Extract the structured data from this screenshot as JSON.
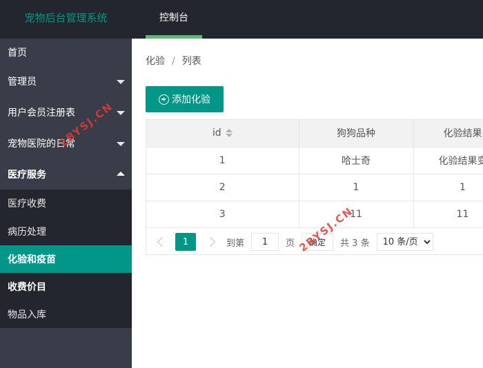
{
  "app": {
    "title": "宠物后台管理系统"
  },
  "topnav": {
    "tab_label": "控制台"
  },
  "sidebar": {
    "items": [
      {
        "label": "首页"
      },
      {
        "label": "管理员"
      },
      {
        "label": "用户会员注册表"
      },
      {
        "label": "宠物医院的日常"
      },
      {
        "label": "医疗服务"
      },
      {
        "label": "医疗收费"
      },
      {
        "label": "病历处理"
      },
      {
        "label": "化验和疫苗"
      },
      {
        "label": "收费价目"
      },
      {
        "label": "物品入库"
      }
    ]
  },
  "breadcrumb": {
    "parent": "化验",
    "separator": "/",
    "current": "列表"
  },
  "toolbar": {
    "add_label": "添加化验"
  },
  "table": {
    "columns": [
      "id",
      "狗狗品种",
      "化验结果"
    ],
    "rows": [
      [
        "1",
        "哈士奇",
        "化验结果变"
      ],
      [
        "2",
        "1",
        "1"
      ],
      [
        "3",
        "11",
        "11"
      ]
    ]
  },
  "pager": {
    "current_page": "1",
    "goto_label": "到第",
    "goto_value": "1",
    "page_suffix": "页",
    "confirm_label": "确定",
    "total_label": "共 3 条",
    "page_size": "10 条/页"
  },
  "watermark": {
    "text": "2BYSJ.CN"
  },
  "colors": {
    "accent": "#009688",
    "topbar": "#23262e",
    "sidebar": "#393d49",
    "tab_underline": "#5fb878"
  },
  "icons": {
    "add": "plus-circle-icon",
    "sort": "sort-icon",
    "expand": "chevron-down-icon",
    "collapse": "chevron-up-icon"
  }
}
